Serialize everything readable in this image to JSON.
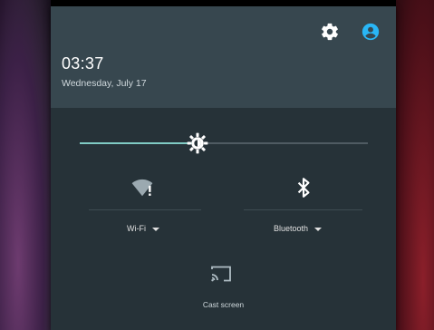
{
  "status": {
    "time": "03:37",
    "date": "Wednesday, July 17"
  },
  "header_icons": {
    "settings": "gear-icon",
    "user": "account-circle-icon",
    "user_color": "#29b6f6"
  },
  "brightness": {
    "level": 0.41,
    "icon": "brightness-icon",
    "accent": "#80cbc4"
  },
  "tiles": {
    "wifi": {
      "label": "Wi-Fi",
      "icon": "wifi-alert-icon"
    },
    "bluetooth": {
      "label": "Bluetooth",
      "icon": "bluetooth-icon"
    },
    "cast": {
      "label": "Cast screen",
      "icon": "cast-icon"
    }
  }
}
